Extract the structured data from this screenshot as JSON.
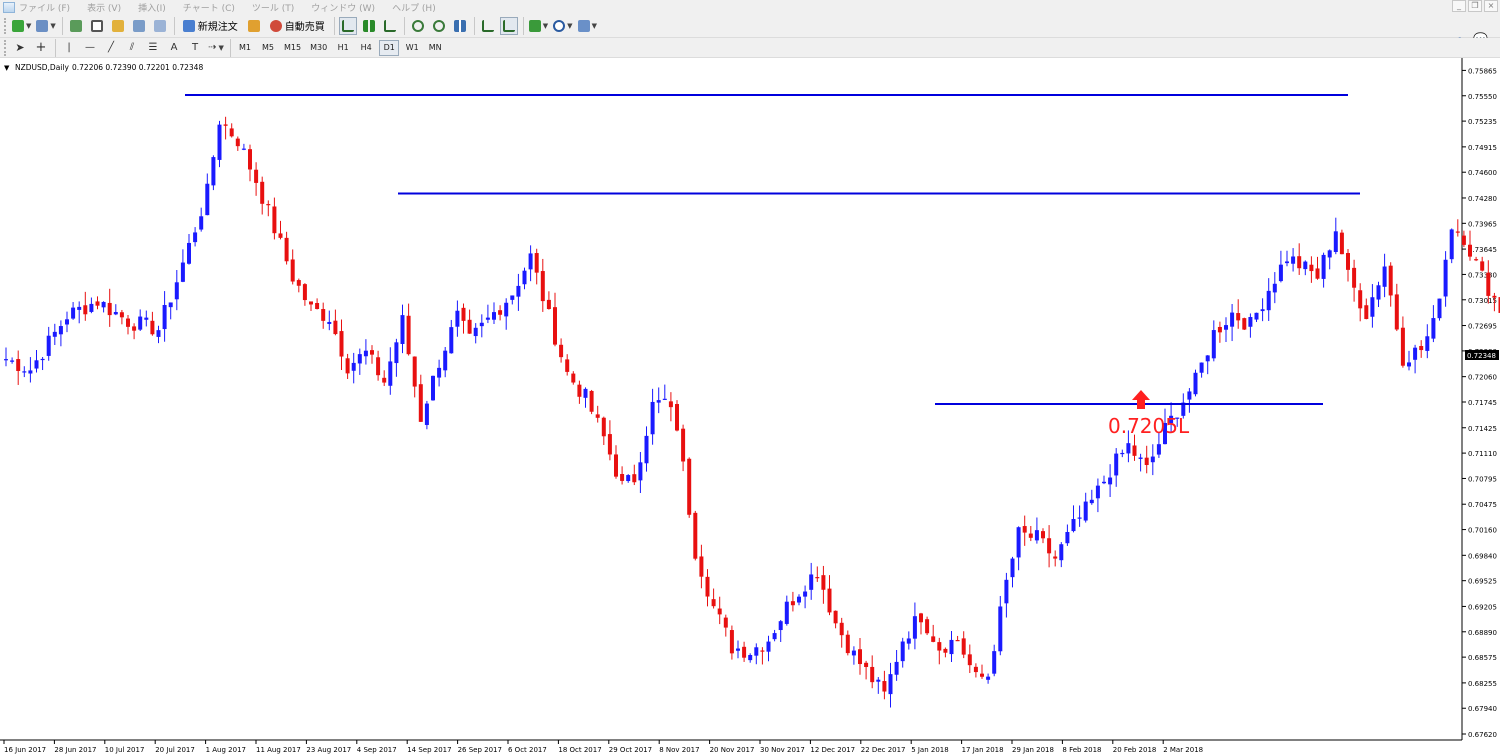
{
  "menu": {
    "items": [
      "ファイル (F)",
      "表示 (V)",
      "挿入(I)",
      "チャート (C)",
      "ツール (T)",
      "ウィンドウ (W)",
      "ヘルプ (H)"
    ]
  },
  "toolbar": {
    "new_order_label": "新規注文",
    "auto_trading_label": "自動売買",
    "timeframes": [
      "M1",
      "M5",
      "M15",
      "M30",
      "H1",
      "H4",
      "D1",
      "W1",
      "MN"
    ],
    "active_timeframe": "D1"
  },
  "chart_header": {
    "symbol_period": "NZDUSD,Daily",
    "ohlc": "0.72206 0.72390 0.72201 0.72348"
  },
  "chart_data": {
    "type": "candlestick",
    "symbol": "NZDUSD",
    "period": "Daily",
    "ylim": [
      0.6762,
      0.7587
    ],
    "y_ticks": [
      "0.75865",
      "0.75550",
      "0.75235",
      "0.74915",
      "0.74600",
      "0.74280",
      "0.73965",
      "0.73645",
      "0.73330",
      "0.73015",
      "0.72695",
      "0.72380",
      "0.72060",
      "0.71745",
      "0.71425",
      "0.71110",
      "0.70795",
      "0.70475",
      "0.70160",
      "0.69840",
      "0.69525",
      "0.69205",
      "0.68890",
      "0.68575",
      "0.68255",
      "0.67940",
      "0.67620"
    ],
    "x_ticks": [
      "16 Jun 2017",
      "28 Jun 2017",
      "10 Jul 2017",
      "20 Jul 2017",
      "1 Aug 2017",
      "11 Aug 2017",
      "23 Aug 2017",
      "4 Sep 2017",
      "14 Sep 2017",
      "26 Sep 2017",
      "6 Oct 2017",
      "18 Oct 2017",
      "29 Oct 2017",
      "8 Nov 2017",
      "20 Nov 2017",
      "30 Nov 2017",
      "12 Dec 2017",
      "22 Dec 2017",
      "5 Jan 2018",
      "17 Jan 2018",
      "29 Jan 2018",
      "8 Feb 2018",
      "20 Feb 2018",
      "2 Mar 2018"
    ],
    "current_price": "0.72348",
    "up_color": "#1a1aff",
    "down_color": "#e81010",
    "anchors": [
      [
        0,
        0.7228
      ],
      [
        4,
        0.7215
      ],
      [
        10,
        0.7282
      ],
      [
        15,
        0.73
      ],
      [
        20,
        0.7275
      ],
      [
        25,
        0.7265
      ],
      [
        28,
        0.7325
      ],
      [
        31,
        0.739
      ],
      [
        33,
        0.7435
      ],
      [
        35,
        0.7525
      ],
      [
        38,
        0.75
      ],
      [
        41,
        0.745
      ],
      [
        44,
        0.739
      ],
      [
        47,
        0.733
      ],
      [
        50,
        0.729
      ],
      [
        53,
        0.728
      ],
      [
        56,
        0.722
      ],
      [
        59,
        0.7235
      ],
      [
        62,
        0.72
      ],
      [
        65,
        0.7275
      ],
      [
        68,
        0.7155
      ],
      [
        71,
        0.7225
      ],
      [
        74,
        0.728
      ],
      [
        76,
        0.725
      ],
      [
        80,
        0.7285
      ],
      [
        83,
        0.731
      ],
      [
        86,
        0.7355
      ],
      [
        89,
        0.728
      ],
      [
        92,
        0.721
      ],
      [
        95,
        0.718
      ],
      [
        98,
        0.713
      ],
      [
        101,
        0.707
      ],
      [
        103,
        0.708
      ],
      [
        106,
        0.717
      ],
      [
        108,
        0.7175
      ],
      [
        110,
        0.7145
      ],
      [
        113,
        0.699
      ],
      [
        116,
        0.692
      ],
      [
        119,
        0.687
      ],
      [
        122,
        0.6865
      ],
      [
        125,
        0.688
      ],
      [
        128,
        0.692
      ],
      [
        131,
        0.695
      ],
      [
        133,
        0.6965
      ],
      [
        136,
        0.69
      ],
      [
        139,
        0.686
      ],
      [
        142,
        0.683
      ],
      [
        144,
        0.681
      ],
      [
        147,
        0.688
      ],
      [
        150,
        0.691
      ],
      [
        153,
        0.687
      ],
      [
        156,
        0.688
      ],
      [
        159,
        0.683
      ],
      [
        161,
        0.6835
      ],
      [
        164,
        0.695
      ],
      [
        166,
        0.701
      ],
      [
        169,
        0.7005
      ],
      [
        172,
        0.698
      ],
      [
        175,
        0.702
      ],
      [
        178,
        0.705
      ],
      [
        181,
        0.709
      ],
      [
        184,
        0.712
      ],
      [
        187,
        0.709
      ],
      [
        190,
        0.714
      ],
      [
        192,
        0.7165
      ],
      [
        195,
        0.72
      ],
      [
        198,
        0.726
      ],
      [
        201,
        0.7285
      ],
      [
        204,
        0.727
      ],
      [
        207,
        0.7315
      ],
      [
        210,
        0.7355
      ],
      [
        212,
        0.7345
      ],
      [
        215,
        0.733
      ],
      [
        218,
        0.739
      ],
      [
        220,
        0.733
      ],
      [
        223,
        0.7285
      ],
      [
        226,
        0.7345
      ],
      [
        229,
        0.723
      ],
      [
        232,
        0.724
      ],
      [
        234,
        0.727
      ],
      [
        237,
        0.7395
      ],
      [
        239,
        0.738
      ],
      [
        242,
        0.733
      ],
      [
        245,
        0.729
      ],
      [
        248,
        0.722
      ],
      [
        250,
        0.721
      ],
      [
        252,
        0.7225
      ],
      [
        254,
        0.7235
      ]
    ],
    "annotations": {
      "lines": [
        {
          "level": 0.7556,
          "from": "20 Jul 2017",
          "to": "2 Mar 2018"
        },
        {
          "level": 0.74335,
          "from": "14 Sep 2017",
          "to": "2 Mar 2018"
        },
        {
          "level": 0.7172,
          "from": "5 Jan 2018",
          "to": "2 Mar 2018"
        }
      ],
      "label": "0.7205L",
      "label_color": "#ff2020",
      "line_color": "#0000dd"
    }
  }
}
